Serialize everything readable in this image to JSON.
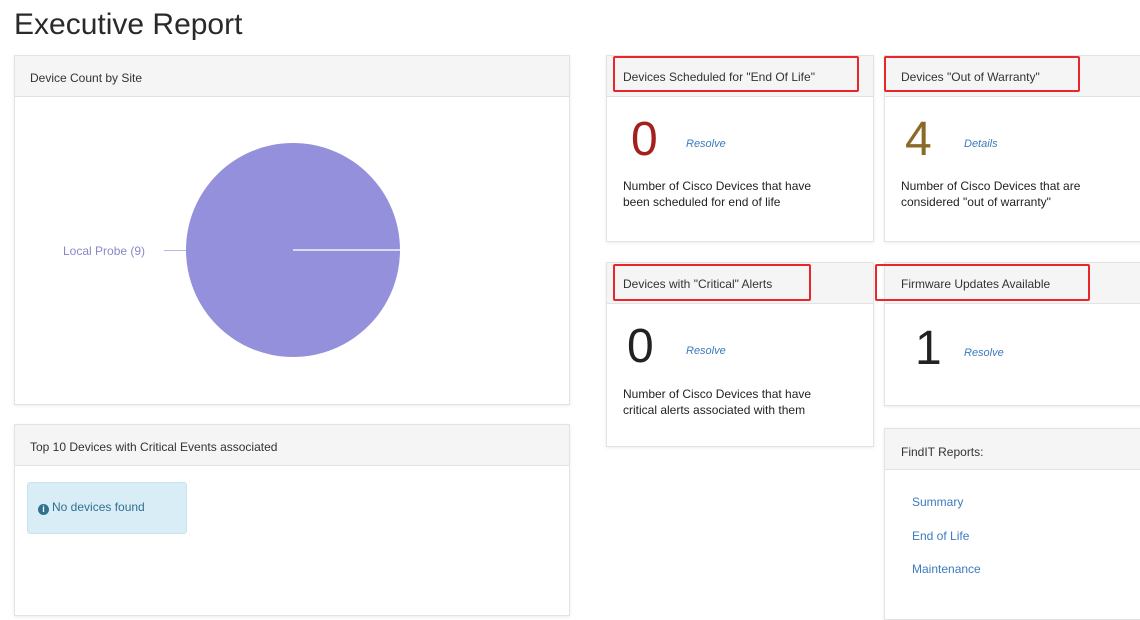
{
  "page": {
    "title": "Executive Report"
  },
  "device_count_panel": {
    "title": "Device Count by Site",
    "label": "Local Probe (9)"
  },
  "critical_events_panel": {
    "title": "Top 10 Devices with Critical Events associated",
    "empty_message": "No devices found"
  },
  "eol_card": {
    "title": "Devices Scheduled for \"End Of Life\"",
    "count": "0",
    "link": "Resolve",
    "description_line1": "Number of Cisco Devices that have",
    "description_line2": "been scheduled for end of life"
  },
  "warranty_card": {
    "title": "Devices \"Out of Warranty\"",
    "count": "4",
    "link": "Details",
    "description_line1": "Number of Cisco Devices that are",
    "description_line2": "considered \"out of warranty\""
  },
  "critical_card": {
    "title": "Devices with \"Critical\" Alerts",
    "count": "0",
    "link": "Resolve",
    "description_line1": "Number of Cisco Devices that have",
    "description_line2": "critical alerts associated with them"
  },
  "firmware_card": {
    "title": "Firmware Updates Available",
    "count": "1",
    "link": "Resolve"
  },
  "reports_panel": {
    "title": "FindIT Reports:",
    "links": [
      "Summary",
      "End of Life",
      "Maintenance"
    ]
  },
  "chart_data": {
    "type": "pie",
    "categories": [
      "Local Probe"
    ],
    "values": [
      9
    ],
    "labels": [
      "Local Probe (9)"
    ],
    "colors": [
      "#9490db"
    ]
  },
  "colors": {
    "highlight": "#e8262c",
    "eol_count": "#a3201f",
    "warranty_count": "#8a6a28",
    "default_count": "#222222",
    "link": "#3b7bbf"
  }
}
